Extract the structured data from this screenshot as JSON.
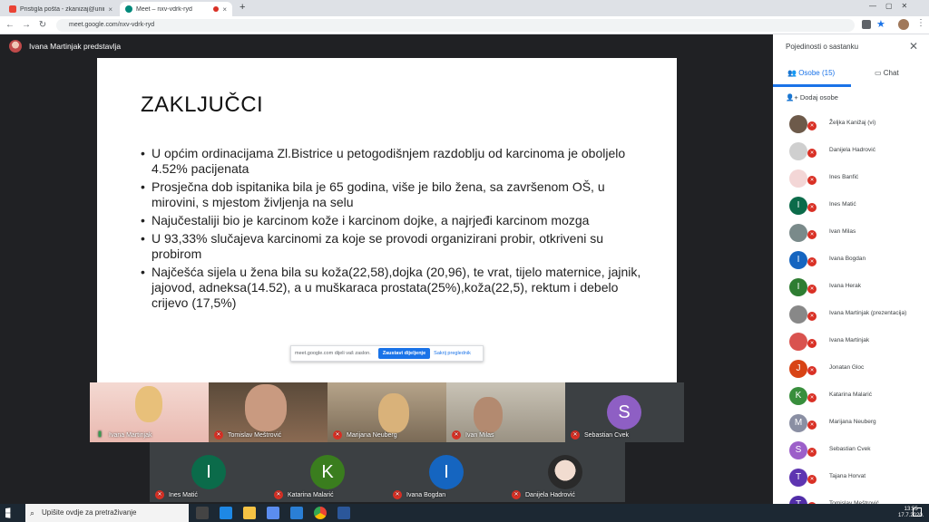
{
  "browser": {
    "tabs": [
      {
        "label": "Pristigla pošta - zkanizaj@unin.h",
        "close": "×"
      },
      {
        "label": "Meet – nxv-vdrk-ryd",
        "close": "×"
      }
    ],
    "new_tab": "+",
    "url": "meet.google.com/nxv-vdrk-ryd",
    "nav": {
      "back": "←",
      "forward": "→",
      "reload": "↻",
      "lock": "🔒"
    }
  },
  "meet": {
    "presenter_label": "Ivana Martinjak predstavlja",
    "slide": {
      "title": "ZAKLJUČCI",
      "bullets": [
        "U općim ordinacijama Zl.Bistrice u petogodišnjem razdoblju od karcinoma je oboljelo 4.52% pacijenata",
        "Prosječna dob ispitanika bila je 65 godina, više je bilo žena, sa završenom OŠ, u mirovini, s mjestom življenja na selu",
        "Najučestaliji bio je karcinom kože i karcinom dojke, a najrjeđi karcinom mozga",
        "U 93,33% slučajeva karcinomi za koje se provodi organizirani probir, otkriveni su probirom",
        "Najčešća sijela u žena bila su koža(22,58),dojka (20,96), te vrat, tijelo maternice, jajnik, jajovod, adneksa(14.52), a u muškaraca prostata(25%),koža(22,5), rektum i debelo crijevo (17,5%)"
      ]
    },
    "share_bar": {
      "text": "meet.google.com dijeli vaš zaslon.",
      "stop": "Zaustavi dijeljenje",
      "hide": "Sakrij preglednik"
    },
    "tiles_row1": [
      {
        "name": "Ivana Martinjak",
        "muted": false
      },
      {
        "name": "Tomislav Meštrović",
        "muted": true
      },
      {
        "name": "Marijana Neuberg",
        "muted": true
      },
      {
        "name": "Ivan Milas",
        "muted": true
      },
      {
        "name": "Sebastian Cvek",
        "muted": true,
        "letter": "S",
        "color": "#8e5fc4"
      }
    ],
    "tiles_row2": [
      {
        "name": "Ines Matić",
        "letter": "I",
        "color": "#0b6b4a"
      },
      {
        "name": "Katarina Malarić",
        "letter": "K",
        "color": "#3a7d1e"
      },
      {
        "name": "Ivana Bogdan",
        "letter": "I",
        "color": "#1565c0"
      },
      {
        "name": "Danijela Hadrović",
        "letter": "",
        "color": "#ddd"
      }
    ]
  },
  "panel": {
    "title": "Pojedinosti o sastanku",
    "close": "✕",
    "tab_people": "Osobe (15)",
    "tab_chat": "Chat",
    "add_people": "Dodaj osobe",
    "people": [
      {
        "name": "Željka Kanižaj (vi)",
        "letter": "",
        "color": "#6d5a4a"
      },
      {
        "name": "Danijela Hadrović",
        "letter": "",
        "color": "#cfcfcf"
      },
      {
        "name": "Ines Banfić",
        "letter": "",
        "color": "#f3d6d6"
      },
      {
        "name": "Ines Matić",
        "letter": "I",
        "color": "#0b6b4a"
      },
      {
        "name": "Ivan Milas",
        "letter": "",
        "color": "#7a8a8a"
      },
      {
        "name": "Ivana Bogdan",
        "letter": "I",
        "color": "#1565c0"
      },
      {
        "name": "Ivana Herak",
        "letter": "I",
        "color": "#2e7d32"
      },
      {
        "name": "Ivana Martinjak (prezentacija)",
        "letter": "",
        "color": "#888"
      },
      {
        "name": "Ivana Martinjak",
        "letter": "",
        "color": "#d9534f"
      },
      {
        "name": "Jonatan Gloc",
        "letter": "J",
        "color": "#d84315"
      },
      {
        "name": "Katarina Malarić",
        "letter": "K",
        "color": "#388e3c"
      },
      {
        "name": "Marijana Neuberg",
        "letter": "M",
        "color": "#8a8fa3"
      },
      {
        "name": "Sebastian Cvek",
        "letter": "S",
        "color": "#9c5fc9"
      },
      {
        "name": "Tajana Horvat",
        "letter": "T",
        "color": "#5e35b1"
      },
      {
        "name": "Tomislav Meštrović",
        "letter": "T",
        "color": "#512da8"
      }
    ]
  },
  "taskbar": {
    "search_placeholder": "Upišite ovdje za pretraživanje",
    "time": "13:55",
    "date": "17.7.2020."
  }
}
